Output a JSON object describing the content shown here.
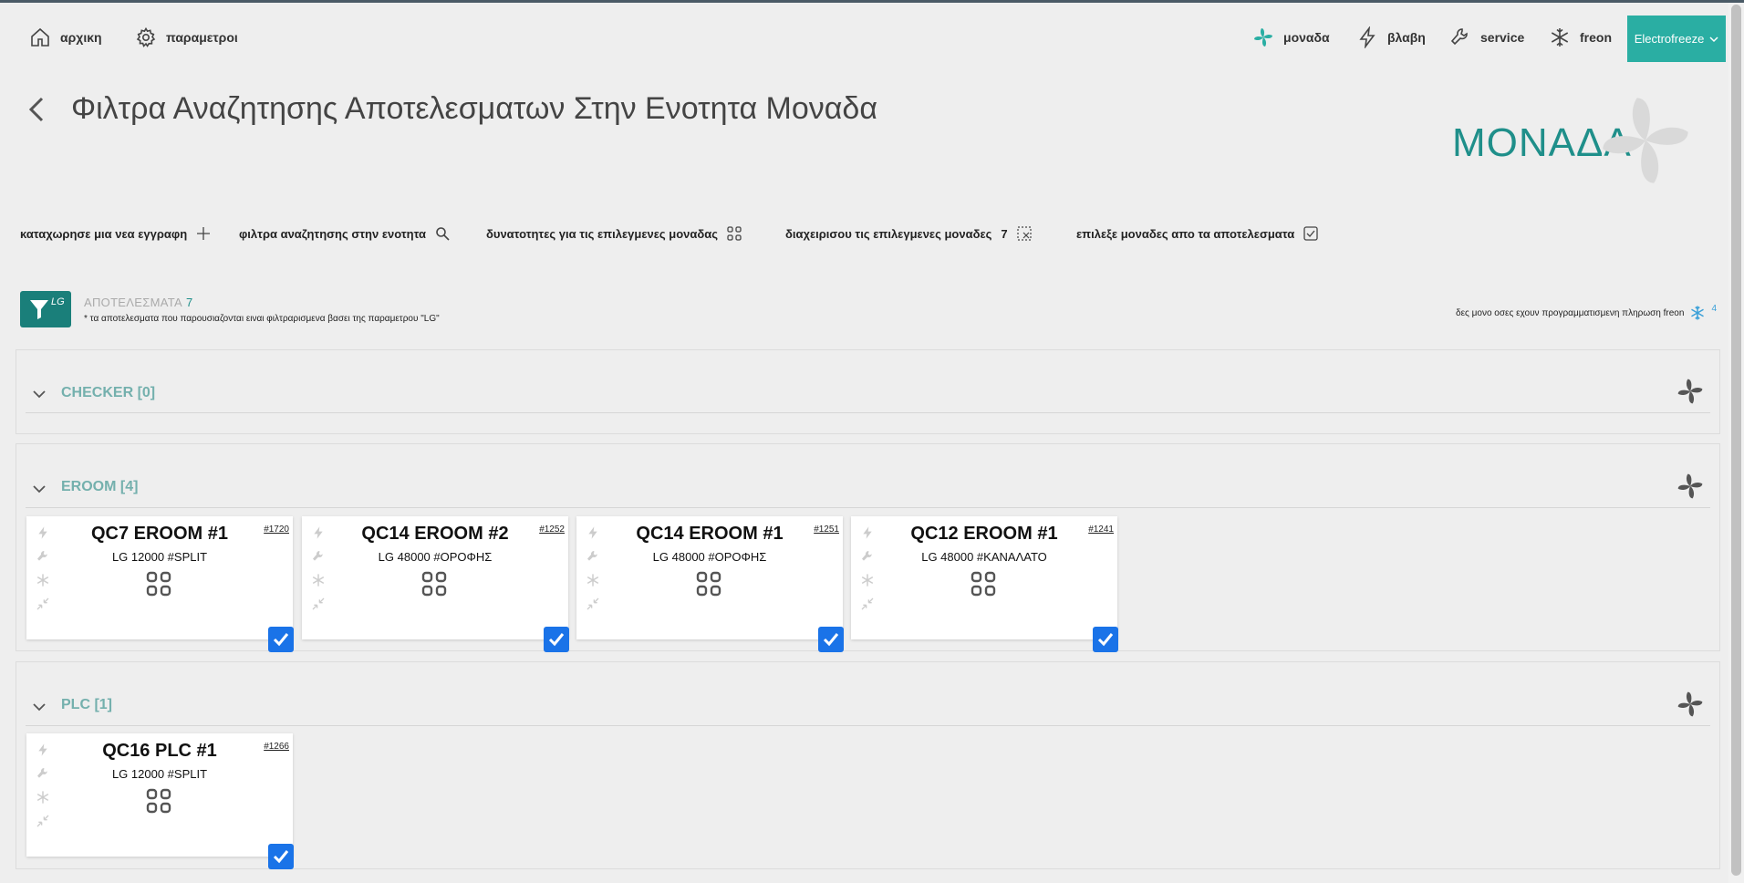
{
  "nav": {
    "home": "αρχικη",
    "params": "παραμετροι",
    "monada": "μοναδα",
    "vlavi": "βλαβη",
    "service": "service",
    "freon": "freon",
    "company": "Electrofreeze"
  },
  "header": {
    "title": "Φιλτρα Αναζητησης Αποτελεσματων Στην Ενοτητα Μοναδα",
    "logo_text": "ΜΟΝΑΔΑ"
  },
  "actions": {
    "new_entry": "καταχωρησε μια νεα εγγραφη",
    "filters": "φιλτρα αναζητησης στην ενοτητα",
    "capabilities": "δυνατοτητες για τις επιλεγμενες μοναδας",
    "manage": "διαχειρισου τις επιλεγμενες μοναδες",
    "manage_count": "7",
    "select_from_results": "επιλεξε μοναδες απο τα αποτελεσματα"
  },
  "results": {
    "filter_tag": "LG",
    "label": "ΑΠΟΤΕΛΕΣΜΑΤΑ",
    "count": "7",
    "note": "* τα αποτελεσματα που παρουσιαζονται ειναι φιλτραρισμενα βασει της παραμετρου \"LG\"",
    "freon_filter": "δες μονο οσες εχουν προγραμματισμενη πληρωση freon",
    "freon_count": "4"
  },
  "groups": [
    {
      "title": "CHECKER [0]",
      "cards": []
    },
    {
      "title": "EROOM [4]",
      "cards": [
        {
          "title": "QC7 EROOM #1",
          "subtitle": "LG 12000 #SPLIT",
          "id": "#1720",
          "checked": true
        },
        {
          "title": "QC14 EROOM #2",
          "subtitle": "LG 48000 #ΟΡΟΦΗΣ",
          "id": "#1252",
          "checked": true
        },
        {
          "title": "QC14 EROOM #1",
          "subtitle": "LG 48000 #ΟΡΟΦΗΣ",
          "id": "#1251",
          "checked": true
        },
        {
          "title": "QC12 EROOM #1",
          "subtitle": "LG 48000 #ΚΑΝΑΛΑΤΟ",
          "id": "#1241",
          "checked": true
        }
      ]
    },
    {
      "title": "PLC [1]",
      "cards": [
        {
          "title": "QC16 PLC #1",
          "subtitle": "LG 12000 #SPLIT",
          "id": "#1266",
          "checked": true
        }
      ]
    }
  ],
  "colors": {
    "accent": "#2aaea3",
    "filter_badge": "#1a7f7a",
    "group_title": "#74b0ad",
    "checkbox": "#1a73e8",
    "freon_icon": "#3aa0d8"
  },
  "icons": {
    "nav": [
      "home-icon",
      "gear-icon",
      "fan-icon",
      "bolt-icon",
      "wrench-icon",
      "snowflake-icon",
      "chevron-down-icon"
    ],
    "card_side": [
      "bolt-icon",
      "wrench-icon",
      "snowflake-icon",
      "compress-icon"
    ]
  }
}
